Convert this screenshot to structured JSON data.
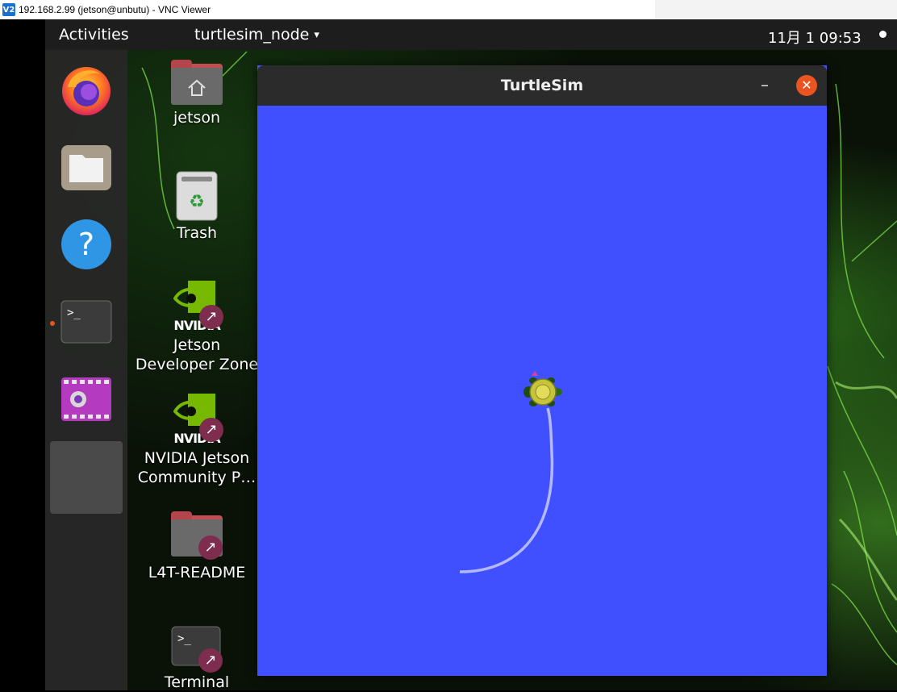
{
  "vnc": {
    "logo": "V2",
    "title": "192.168.2.99 (jetson@unbutu) - VNC Viewer"
  },
  "top_panel": {
    "activities": "Activities",
    "app_menu": "turtlesim_node",
    "app_menu_caret": "▾",
    "clock": "11月 1  09:53"
  },
  "dock": {
    "items": [
      {
        "name": "firefox-icon",
        "running": false
      },
      {
        "name": "files-icon",
        "running": false
      },
      {
        "name": "help-icon",
        "running": false
      },
      {
        "name": "terminal-icon",
        "running": true
      },
      {
        "name": "video-icon",
        "running": false
      },
      {
        "name": "turtlesim-app-icon",
        "running": true
      }
    ]
  },
  "desktop": {
    "icons": [
      {
        "label": "jetson",
        "icon": "home-folder-icon"
      },
      {
        "label": "Trash",
        "icon": "trash-icon"
      },
      {
        "label": "Jetson\nDeveloper Zone",
        "icon": "nvidia-link-icon",
        "line1": "Jetson",
        "line2": "Developer Zone"
      },
      {
        "label": "NVIDIA Jetson Community P…",
        "icon": "nvidia-link-icon",
        "line1": "NVIDIA Jetson",
        "line2": "Community P…"
      },
      {
        "label": "L4T-README",
        "icon": "folder-link-icon"
      },
      {
        "label": "Terminal",
        "icon": "terminal-link-icon"
      }
    ],
    "nvidia_text": "NVIDIA"
  },
  "turtlesim": {
    "title": "TurtleSim",
    "minimize": "–",
    "close": "✕",
    "background": "#4150ff",
    "pen_color": "#b3b8ff"
  },
  "colors": {
    "accent": "#e95420",
    "link_badge": "#7e2d4e"
  }
}
